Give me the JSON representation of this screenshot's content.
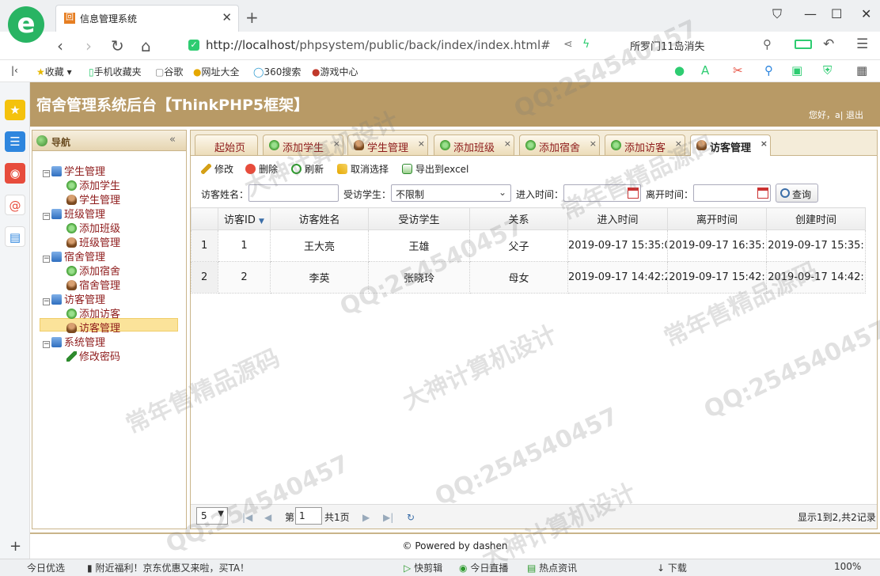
{
  "browser": {
    "logo": "e",
    "tab_title": "信息管理系统",
    "tab_icon": "回",
    "url_host": "http://localhost",
    "url_path": "/phpsystem/public/back/index/index.html#",
    "search_query": "所罗门11岛消失",
    "bookmarks": [
      "收藏",
      "手机收藏夹",
      "谷歌",
      "网址大全",
      "360搜索",
      "游戏中心"
    ]
  },
  "app": {
    "title": "宿舍管理系统后台【ThinkPHP5框架】",
    "greeting": "您好，a|",
    "logout": "退出",
    "footer": "© Powered by dashen"
  },
  "sidebar": {
    "title": "导航",
    "collapse": "«",
    "groups": [
      {
        "label": "学生管理",
        "items": [
          "添加学生",
          "学生管理"
        ]
      },
      {
        "label": "班级管理",
        "items": [
          "添加班级",
          "班级管理"
        ]
      },
      {
        "label": "宿舍管理",
        "items": [
          "添加宿舍",
          "宿舍管理"
        ]
      },
      {
        "label": "访客管理",
        "items": [
          "添加访客",
          "访客管理"
        ]
      },
      {
        "label": "系统管理",
        "items": [
          "修改密码"
        ]
      }
    ]
  },
  "tabs": [
    "起始页",
    "添加学生",
    "学生管理",
    "添加班级",
    "添加宿舍",
    "添加访客",
    "访客管理"
  ],
  "toolbar": {
    "edit": "修改",
    "delete": "删除",
    "refresh": "刷新",
    "cancel_select": "取消选择",
    "export": "导出到excel"
  },
  "filters": {
    "visitor_name_label": "访客姓名：",
    "student_label": "受访学生：",
    "student_value": "不限制",
    "enter_time_label": "进入时间：",
    "leave_time_label": "离开时间：",
    "query": "查询"
  },
  "grid": {
    "columns": [
      "访客ID",
      "访客姓名",
      "受访学生",
      "关系",
      "进入时间",
      "离开时间",
      "创建时间"
    ],
    "sort_indicator": "▼",
    "rows": [
      {
        "n": "1",
        "cells": [
          "1",
          "王大亮",
          "王雄",
          "父子",
          "2019-09-17 15:35:0",
          "2019-09-17 16:35:",
          "2019-09-17 15:35:"
        ]
      },
      {
        "n": "2",
        "cells": [
          "2",
          "李英",
          "张晓玲",
          "母女",
          "2019-09-17 14:42:2",
          "2019-09-17 15:42:",
          "2019-09-17 14:42:"
        ]
      }
    ]
  },
  "pager": {
    "page_size": "5",
    "page_prefix": "第",
    "page_value": "1",
    "page_total": "共1页",
    "info": "显示1到2,共2记录"
  },
  "statusbar": [
    "今日优选",
    "附近福利！京东优惠又来啦，买TA！",
    "快剪辑",
    "今日直播",
    "热点资讯",
    "下载",
    "100%"
  ],
  "watermarks": [
    "QQ:254540457",
    "常年售精品源码",
    "大神计算机设计"
  ]
}
